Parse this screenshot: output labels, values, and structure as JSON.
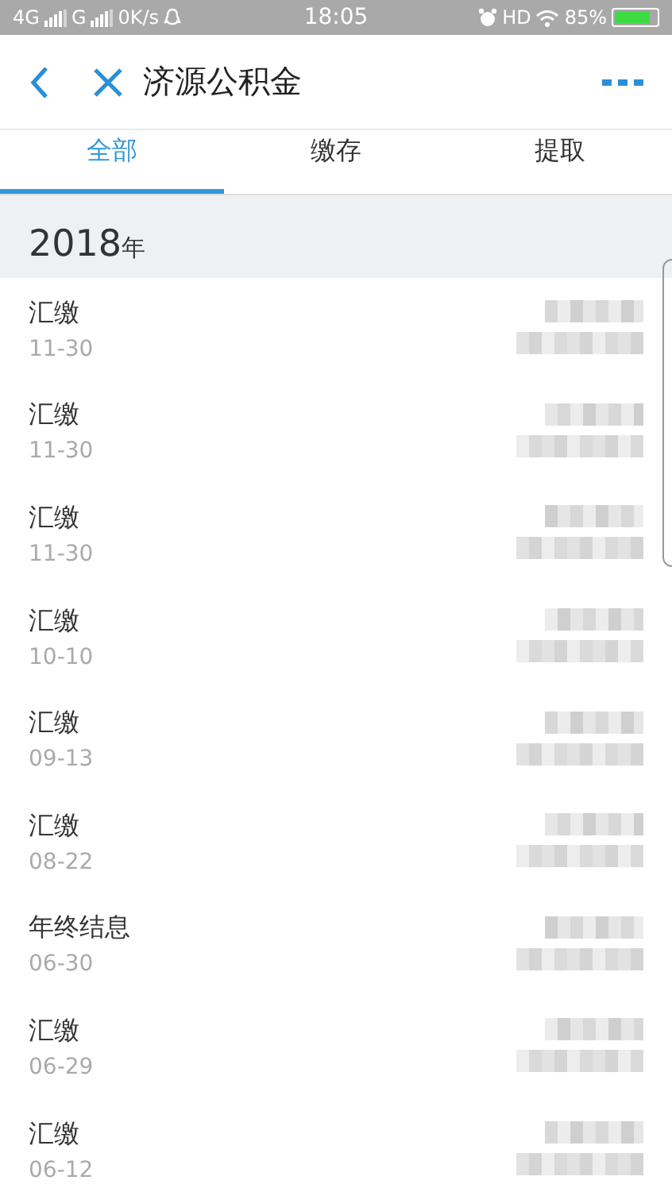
{
  "status_bar": {
    "network_1": "4G",
    "network_2": "G",
    "speed": "0K/s",
    "time": "18:05",
    "hd": "HD",
    "battery": "85%"
  },
  "header": {
    "title": "济源公积金"
  },
  "tabs": [
    {
      "label": "全部",
      "selected": true
    },
    {
      "label": "缴存",
      "selected": false
    },
    {
      "label": "提取",
      "selected": false
    }
  ],
  "year": {
    "value": "2018",
    "unit": "年"
  },
  "records": [
    {
      "type": "汇缴",
      "date": "11-30"
    },
    {
      "type": "汇缴",
      "date": "11-30"
    },
    {
      "type": "汇缴",
      "date": "11-30"
    },
    {
      "type": "汇缴",
      "date": "10-10"
    },
    {
      "type": "汇缴",
      "date": "09-13"
    },
    {
      "type": "汇缴",
      "date": "08-22"
    },
    {
      "type": "年终结息",
      "date": "06-30"
    },
    {
      "type": "汇缴",
      "date": "06-29"
    },
    {
      "type": "汇缴",
      "date": "06-12"
    }
  ]
}
